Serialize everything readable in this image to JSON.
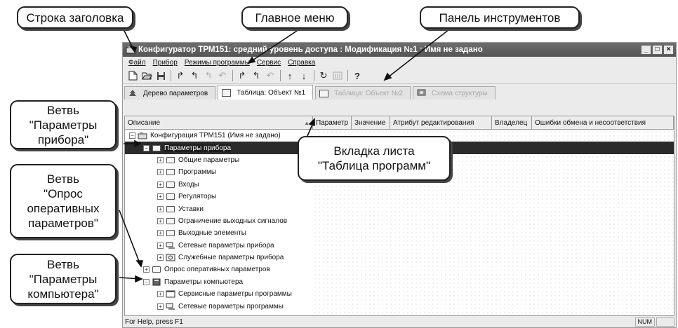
{
  "callouts": {
    "title_bar": "Строка заголовка",
    "main_menu": "Главное меню",
    "toolbar": "Панель инструментов",
    "branch_device_params": "Ветвь\n\"Параметры\nприбора\"",
    "branch_poll": "Ветвь\n\"Опрос\nоперативных\nпараметров\"",
    "branch_computer_params": "Ветвь\n\"Параметры\nкомпьютера\"",
    "programs_tab": "Вкладка листа\n\"Таблица программ\""
  },
  "window": {
    "title": "Конфигуратор ТРМ151: средний уровень доступа : Модификация №1 : Имя не задано",
    "buttons": [
      "_",
      "□",
      "×"
    ]
  },
  "menu": [
    "Файл",
    "Прибор",
    "Режимы программы",
    "Сервис",
    "Справка"
  ],
  "toolbar_icons": [
    "new-file-icon",
    "open-folder-icon",
    "save-icon",
    "redo-icon",
    "undo-icon",
    "undo-all-icon",
    "undo-branch-icon",
    "redo-device-icon",
    "undo-device-icon",
    "undo-device-all-icon",
    "arrow-up-icon",
    "arrow-down-icon",
    "refresh-icon",
    "device-icon",
    "help-icon"
  ],
  "tabs": [
    {
      "label": "Дерево параметров",
      "icon": "tree-icon"
    },
    {
      "label": "Таблица: Объект №1",
      "icon": "table-icon"
    },
    {
      "label": "Таблица: Объект №2",
      "icon": "table-icon"
    },
    {
      "label": "Схема структуры",
      "icon": "scheme-icon"
    }
  ],
  "columns": [
    "Описание",
    "Параметр",
    "Значение",
    "Атрибут редактирования",
    "Владелец",
    "Ошибки обмена и несоответствия"
  ],
  "tree": [
    {
      "label": "Конфигурация ТРМ151 (Имя не задано)",
      "level": 0,
      "expander": "−",
      "icon": "configuration-icon"
    },
    {
      "label": "Параметры прибора",
      "level": 1,
      "expander": "−",
      "icon": "folder-icon",
      "selected": true
    },
    {
      "label": "Общие параметры",
      "level": 2,
      "expander": "+",
      "icon": "folder-icon"
    },
    {
      "label": "Программы",
      "level": 2,
      "expander": "+",
      "icon": "folder-icon"
    },
    {
      "label": "Входы",
      "level": 2,
      "expander": "+",
      "icon": "folder-icon"
    },
    {
      "label": "Регуляторы",
      "level": 2,
      "expander": "+",
      "icon": "folder-icon"
    },
    {
      "label": "Уставки",
      "level": 2,
      "expander": "+",
      "icon": "folder-icon"
    },
    {
      "label": "Ограничение выходных сигналов",
      "level": 2,
      "expander": "+",
      "icon": "folder-icon"
    },
    {
      "label": "Выходные элементы",
      "level": 2,
      "expander": "+",
      "icon": "folder-icon"
    },
    {
      "label": "Сетевые параметры прибора",
      "level": 2,
      "expander": "+",
      "icon": "network-icon"
    },
    {
      "label": "Служебные параметры прибора",
      "level": 2,
      "expander": "+",
      "icon": "service-icon"
    },
    {
      "label": "Опрос оперативных параметров",
      "level": 1,
      "expander": "+",
      "icon": "folder-icon"
    },
    {
      "label": "Параметры компьютера",
      "level": 1,
      "expander": "−",
      "icon": "book-icon"
    },
    {
      "label": "Сервисные параметры программы",
      "level": 2,
      "expander": "+",
      "icon": "window-icon"
    },
    {
      "label": "Сетевые параметры программы",
      "level": 2,
      "expander": "+",
      "icon": "network-icon"
    }
  ],
  "status": {
    "help": "For Help, press F1",
    "num": "NUM"
  }
}
